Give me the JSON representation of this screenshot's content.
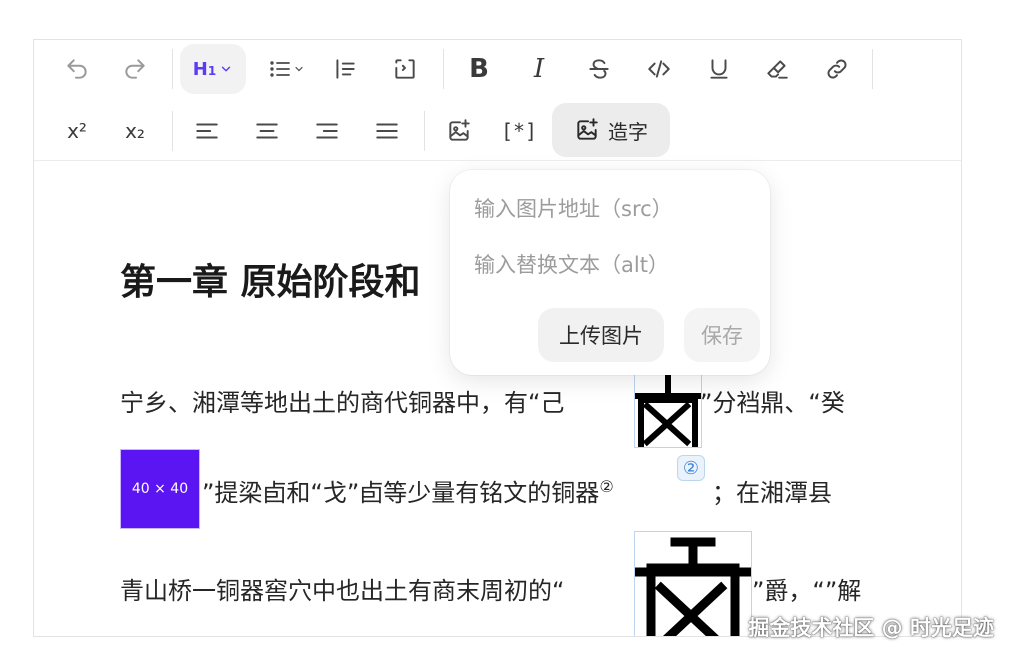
{
  "toolbar": {
    "row1": [
      {
        "id": "undo",
        "icon": "undo-icon",
        "disabled": true
      },
      {
        "id": "redo",
        "icon": "redo-icon",
        "disabled": true
      },
      {
        "id": "heading",
        "label": "H1",
        "icon": "chevron-down-icon",
        "active": true
      },
      {
        "id": "bullet-list",
        "icon": "bullet-list-icon"
      },
      {
        "id": "ordered-list",
        "icon": "ordered-list-icon"
      },
      {
        "id": "code-block",
        "icon": "code-block-icon"
      },
      {
        "id": "bold",
        "label": "B"
      },
      {
        "id": "italic",
        "label": "I"
      },
      {
        "id": "strike",
        "icon": "strikethrough-icon"
      },
      {
        "id": "code",
        "icon": "code-icon"
      },
      {
        "id": "underline",
        "icon": "underline-icon"
      },
      {
        "id": "highlight",
        "icon": "highlighter-icon"
      },
      {
        "id": "link",
        "icon": "link-icon"
      }
    ],
    "row2": [
      {
        "id": "superscript",
        "label": "x²"
      },
      {
        "id": "subscript",
        "label": "x₂"
      },
      {
        "id": "align-left",
        "icon": "align-left-icon"
      },
      {
        "id": "align-center",
        "icon": "align-center-icon"
      },
      {
        "id": "align-right",
        "icon": "align-right-icon"
      },
      {
        "id": "align-justify",
        "icon": "align-justify-icon"
      },
      {
        "id": "image",
        "icon": "image-add-icon"
      },
      {
        "id": "footnote",
        "label": "[*]"
      },
      {
        "id": "zaozi",
        "label": "造字",
        "icon": "image-add-icon"
      }
    ]
  },
  "content": {
    "heading": "第一章 原始阶段和",
    "line1_a": "宁乡、湘潭等地出土的商代铜器中，有“己",
    "line1_b": "”分裆鼎、“癸",
    "line2_a": "”提梁卣和“戈”卣等少量有铭文的铜器",
    "line2_sup": "②",
    "line2_badge": "②",
    "line2_b": "；在湘潭县",
    "line3_a": "青山桥一铜器窖穴中也出土有商末周初的“",
    "line3_b": "”爵，“”解",
    "placeholder_img": "40 × 40"
  },
  "popover": {
    "src_placeholder": "输入图片地址（src）",
    "alt_placeholder": "输入替换文本（alt）",
    "upload_label": "上传图片",
    "save_label": "保存"
  },
  "watermark": "掘金技术社区 @ 时光足迹",
  "colors": {
    "accent": "#5b3bf5",
    "placeholder_bg": "#5b14f2",
    "border": "#e3e3e3"
  }
}
